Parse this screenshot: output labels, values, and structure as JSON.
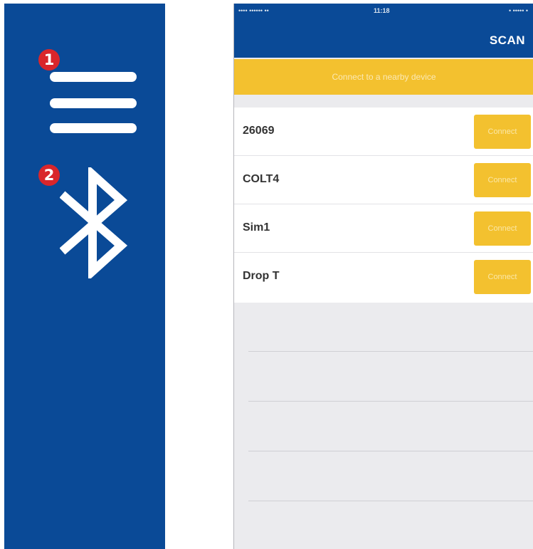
{
  "callouts": {
    "menu": "1",
    "bluetooth": "2"
  },
  "icons": {
    "menu": "hamburger-menu-icon",
    "bluetooth": "bluetooth-icon"
  },
  "colors": {
    "brand_blue": "#0a4a97",
    "accent_yellow": "#f3c12f",
    "callout_red": "#d9262b"
  },
  "status_bar": {
    "carrier": "•••• •••••• ••",
    "time": "11:18",
    "battery": "• ••••• •"
  },
  "header": {
    "scan_label": "SCAN"
  },
  "banner": {
    "text": "Connect to a nearby device"
  },
  "devices": [
    {
      "name": "26069",
      "action": "Connect"
    },
    {
      "name": "COLT4",
      "action": "Connect"
    },
    {
      "name": "Sim1",
      "action": "Connect"
    },
    {
      "name": "Drop T",
      "action": "Connect"
    }
  ]
}
